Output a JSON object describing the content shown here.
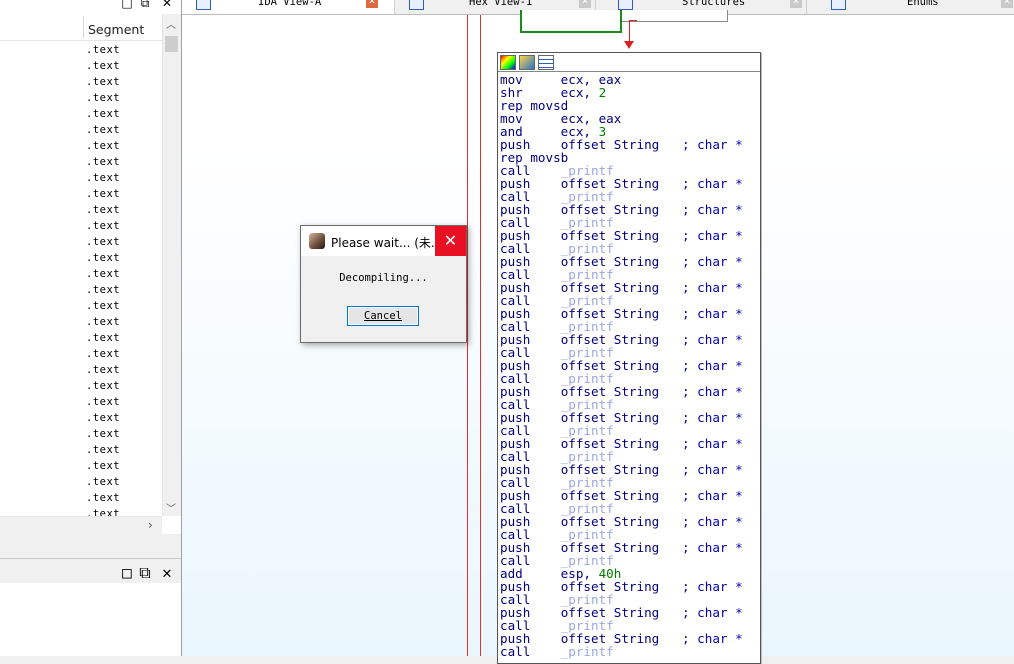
{
  "segments_pane": {
    "column_header": "Segment",
    "rows": [
      ".text",
      ".text",
      ".text",
      ".text",
      ".text",
      ".text",
      ".text",
      ".text",
      ".text",
      ".text",
      ".text",
      ".text",
      ".text",
      ".text",
      ".text",
      ".text",
      ".text",
      ".text",
      ".text",
      ".text",
      ".text",
      ".text",
      ".text",
      ".text",
      ".text",
      ".text",
      ".text",
      ".text",
      ".text",
      ".text"
    ]
  },
  "pane_buttons": {
    "restore": "□",
    "float": "⧉",
    "close": "✕"
  },
  "tabs": [
    {
      "label": "IDA View-A",
      "icon": "document-icon",
      "active": true
    },
    {
      "label": "Hex View-1",
      "icon": "hex-icon",
      "active": false
    },
    {
      "label": "Structures",
      "icon": "struct-icon",
      "active": false
    },
    {
      "label": "Enums",
      "icon": "enum-icon",
      "active": false
    }
  ],
  "code": [
    {
      "mn": "mov",
      "op": "ecx, eax"
    },
    {
      "mn": "shr",
      "op": "ecx, ",
      "num": "2"
    },
    {
      "mn": "rep movsd",
      "op": ""
    },
    {
      "mn": "mov",
      "op": "ecx, eax"
    },
    {
      "mn": "and",
      "op": "ecx, ",
      "num": "3"
    },
    {
      "mn": "push",
      "op": "offset String",
      "cmt": "; char *"
    },
    {
      "mn": "rep movsb",
      "op": ""
    },
    {
      "mn": "call",
      "func": "_printf"
    },
    {
      "mn": "push",
      "op": "offset String",
      "cmt": "; char *"
    },
    {
      "mn": "call",
      "func": "_printf"
    },
    {
      "mn": "push",
      "op": "offset String",
      "cmt": "; char *"
    },
    {
      "mn": "call",
      "func": "_printf"
    },
    {
      "mn": "push",
      "op": "offset String",
      "cmt": "; char *"
    },
    {
      "mn": "call",
      "func": "_printf"
    },
    {
      "mn": "push",
      "op": "offset String",
      "cmt": "; char *"
    },
    {
      "mn": "call",
      "func": "_printf"
    },
    {
      "mn": "push",
      "op": "offset String",
      "cmt": "; char *"
    },
    {
      "mn": "call",
      "func": "_printf"
    },
    {
      "mn": "push",
      "op": "offset String",
      "cmt": "; char *"
    },
    {
      "mn": "call",
      "func": "_printf"
    },
    {
      "mn": "push",
      "op": "offset String",
      "cmt": "; char *"
    },
    {
      "mn": "call",
      "func": "_printf"
    },
    {
      "mn": "push",
      "op": "offset String",
      "cmt": "; char *"
    },
    {
      "mn": "call",
      "func": "_printf"
    },
    {
      "mn": "push",
      "op": "offset String",
      "cmt": "; char *"
    },
    {
      "mn": "call",
      "func": "_printf"
    },
    {
      "mn": "push",
      "op": "offset String",
      "cmt": "; char *"
    },
    {
      "mn": "call",
      "func": "_printf"
    },
    {
      "mn": "push",
      "op": "offset String",
      "cmt": "; char *"
    },
    {
      "mn": "call",
      "func": "_printf"
    },
    {
      "mn": "push",
      "op": "offset String",
      "cmt": "; char *"
    },
    {
      "mn": "call",
      "func": "_printf"
    },
    {
      "mn": "push",
      "op": "offset String",
      "cmt": "; char *"
    },
    {
      "mn": "call",
      "func": "_printf"
    },
    {
      "mn": "push",
      "op": "offset String",
      "cmt": "; char *"
    },
    {
      "mn": "call",
      "func": "_printf"
    },
    {
      "mn": "push",
      "op": "offset String",
      "cmt": "; char *"
    },
    {
      "mn": "call",
      "func": "_printf"
    },
    {
      "mn": "add",
      "op": "esp, ",
      "num": "40h"
    },
    {
      "mn": "push",
      "op": "offset String",
      "cmt": "; char *"
    },
    {
      "mn": "call",
      "func": "_printf"
    },
    {
      "mn": "push",
      "op": "offset String",
      "cmt": "; char *"
    },
    {
      "mn": "call",
      "func": "_printf"
    },
    {
      "mn": "push",
      "op": "offset String",
      "cmt": "; char *"
    },
    {
      "mn": "call",
      "func": "_printf"
    }
  ],
  "dialog": {
    "title": "Please wait... (未...",
    "message": "Decompiling...",
    "cancel_label": "Cancel",
    "close_glyph": "✕"
  },
  "colors": {
    "mnemonic": "#00007f",
    "number": "#008000",
    "function_ref": "#9aa8e0",
    "branch_true": "#1f8a1f",
    "branch_false": "#e02020",
    "dialog_close": "#e81123"
  }
}
